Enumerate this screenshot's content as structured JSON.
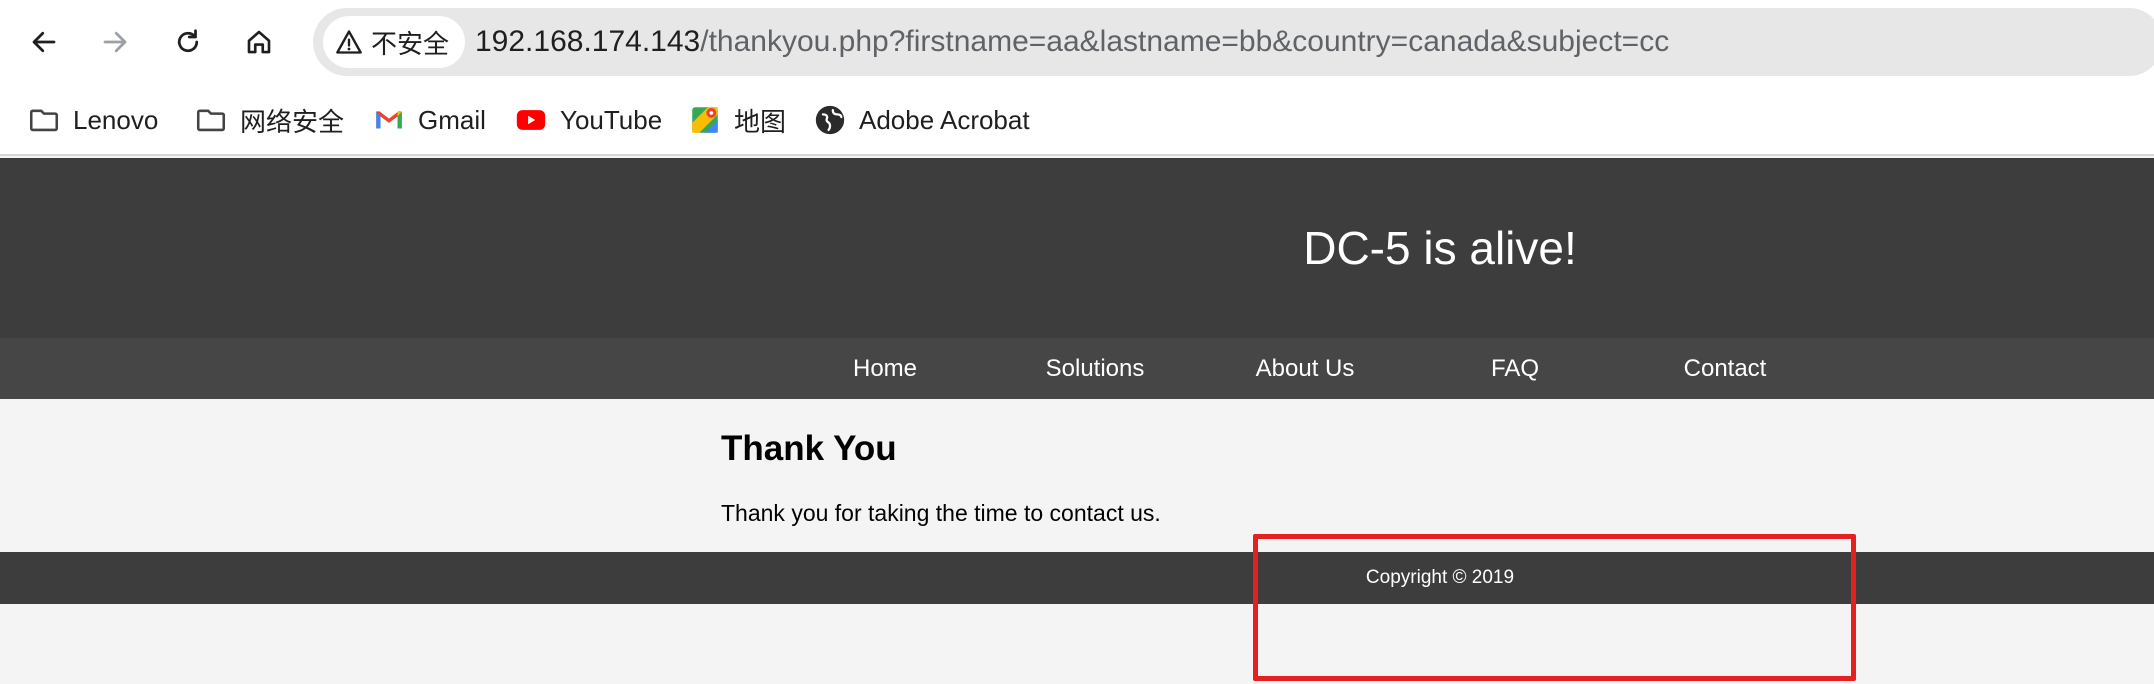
{
  "browser": {
    "security_label": "不安全",
    "url_host": "192.168.174.143",
    "url_path": "/thankyou.php?firstname=aa&lastname=bb&country=canada&subject=cc"
  },
  "bookmarks": [
    {
      "label": "Lenovo",
      "icon": "folder-icon"
    },
    {
      "label": "网络安全",
      "icon": "folder-icon"
    },
    {
      "label": "Gmail",
      "icon": "gmail-icon"
    },
    {
      "label": "YouTube",
      "icon": "youtube-icon"
    },
    {
      "label": "地图",
      "icon": "maps-icon"
    },
    {
      "label": "Adobe Acrobat",
      "icon": "globe-icon"
    }
  ],
  "site": {
    "title": "DC-5 is alive!",
    "nav": [
      "Home",
      "Solutions",
      "About Us",
      "FAQ",
      "Contact"
    ],
    "heading": "Thank You",
    "body": "Thank you for taking the time to contact us.",
    "footer": "Copyright © 2019"
  },
  "colors": {
    "header_bg": "#3d3d3d",
    "nav_bg": "#464646",
    "content_bg": "#f4f4f4",
    "highlight": "#e52020"
  }
}
